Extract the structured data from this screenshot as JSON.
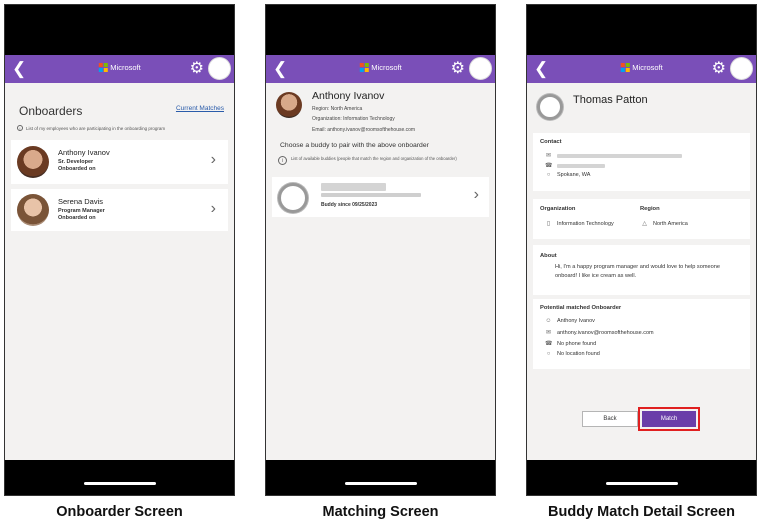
{
  "brand": {
    "name": "Microsoft",
    "logo_colors": [
      "#f25022",
      "#7fba00",
      "#00a4ef",
      "#ffb900"
    ]
  },
  "colors": {
    "header": "#7a4fb8",
    "match_button": "#6a3ea9",
    "highlight": "#e02020",
    "link": "#2a5caa"
  },
  "icons": {
    "back": "back-chevron-icon",
    "settings": "gear-icon",
    "profile": "avatar-icon"
  },
  "screen1": {
    "caption": "Onboarder Screen",
    "title": "Onboarders",
    "link": "Current Matches",
    "note": "List of my employees who are participating in the onboarding program",
    "items": [
      {
        "name": "Anthony Ivanov",
        "role": "Sr. Developer",
        "status": "Onboarded on"
      },
      {
        "name": "Serena Davis",
        "role": "Program Manager",
        "status": "Onboarded on"
      }
    ]
  },
  "screen2": {
    "caption": "Matching Screen",
    "name": "Anthony Ivanov",
    "region": "Region: North America",
    "organization": "Organization: Information Technology",
    "email": "Email: anthony.ivanov@roomsofthehouse.com",
    "choose": "Choose a buddy to pair with the above onboarder",
    "note": "List of available buddies (people that match the region and organization of the onboarder)",
    "buddy_since": "Buddy since 09/25/2023"
  },
  "screen3": {
    "caption": "Buddy Match Detail Screen",
    "name": "Thomas Patton",
    "contact_label": "Contact",
    "location": "Spokane, WA",
    "organization_label": "Organization",
    "organization": "Information Technology",
    "region_label": "Region",
    "region": "North America",
    "about_label": "About",
    "about": "Hi, I'm a happy program manager and would love to help someone onboard! I like ice cream as well.",
    "potential_label": "Potential matched Onboarder",
    "onboarder_name": "Anthony Ivanov",
    "onboarder_email": "anthony.ivanov@roomsofthehouse.com",
    "phone": "No phone found",
    "loc": "No location found",
    "back_btn": "Back",
    "match_btn": "Match"
  }
}
